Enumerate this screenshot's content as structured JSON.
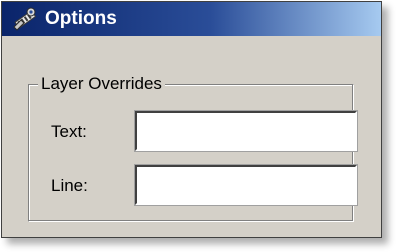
{
  "window": {
    "title": "Options",
    "icon": "options-wrench-icon"
  },
  "layer_overrides": {
    "legend": "Layer Overrides",
    "text": {
      "label": "Text:",
      "value": ""
    },
    "line": {
      "label": "Line:",
      "value": ""
    }
  },
  "colors": {
    "titlebar_start": "#0a246a",
    "titlebar_end": "#a6caf0",
    "window_face": "#d4d0c8"
  }
}
